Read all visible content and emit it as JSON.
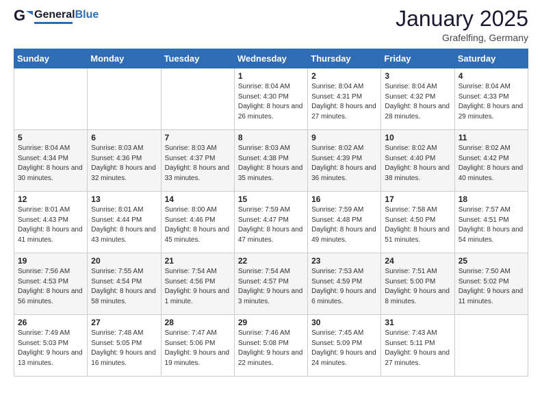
{
  "header": {
    "logo_general": "General",
    "logo_blue": "Blue",
    "month_title": "January 2025",
    "location": "Grafelfing, Germany"
  },
  "days_of_week": [
    "Sunday",
    "Monday",
    "Tuesday",
    "Wednesday",
    "Thursday",
    "Friday",
    "Saturday"
  ],
  "weeks": [
    [
      {
        "day": null
      },
      {
        "day": null
      },
      {
        "day": null
      },
      {
        "day": "1",
        "sunrise": "8:04 AM",
        "sunset": "4:30 PM",
        "daylight": "8 hours and 26 minutes."
      },
      {
        "day": "2",
        "sunrise": "8:04 AM",
        "sunset": "4:31 PM",
        "daylight": "8 hours and 27 minutes."
      },
      {
        "day": "3",
        "sunrise": "8:04 AM",
        "sunset": "4:32 PM",
        "daylight": "8 hours and 28 minutes."
      },
      {
        "day": "4",
        "sunrise": "8:04 AM",
        "sunset": "4:33 PM",
        "daylight": "8 hours and 29 minutes."
      }
    ],
    [
      {
        "day": "5",
        "sunrise": "8:04 AM",
        "sunset": "4:34 PM",
        "daylight": "8 hours and 30 minutes."
      },
      {
        "day": "6",
        "sunrise": "8:03 AM",
        "sunset": "4:36 PM",
        "daylight": "8 hours and 32 minutes."
      },
      {
        "day": "7",
        "sunrise": "8:03 AM",
        "sunset": "4:37 PM",
        "daylight": "8 hours and 33 minutes."
      },
      {
        "day": "8",
        "sunrise": "8:03 AM",
        "sunset": "4:38 PM",
        "daylight": "8 hours and 35 minutes."
      },
      {
        "day": "9",
        "sunrise": "8:02 AM",
        "sunset": "4:39 PM",
        "daylight": "8 hours and 36 minutes."
      },
      {
        "day": "10",
        "sunrise": "8:02 AM",
        "sunset": "4:40 PM",
        "daylight": "8 hours and 38 minutes."
      },
      {
        "day": "11",
        "sunrise": "8:02 AM",
        "sunset": "4:42 PM",
        "daylight": "8 hours and 40 minutes."
      }
    ],
    [
      {
        "day": "12",
        "sunrise": "8:01 AM",
        "sunset": "4:43 PM",
        "daylight": "8 hours and 41 minutes."
      },
      {
        "day": "13",
        "sunrise": "8:01 AM",
        "sunset": "4:44 PM",
        "daylight": "8 hours and 43 minutes."
      },
      {
        "day": "14",
        "sunrise": "8:00 AM",
        "sunset": "4:46 PM",
        "daylight": "8 hours and 45 minutes."
      },
      {
        "day": "15",
        "sunrise": "7:59 AM",
        "sunset": "4:47 PM",
        "daylight": "8 hours and 47 minutes."
      },
      {
        "day": "16",
        "sunrise": "7:59 AM",
        "sunset": "4:48 PM",
        "daylight": "8 hours and 49 minutes."
      },
      {
        "day": "17",
        "sunrise": "7:58 AM",
        "sunset": "4:50 PM",
        "daylight": "8 hours and 51 minutes."
      },
      {
        "day": "18",
        "sunrise": "7:57 AM",
        "sunset": "4:51 PM",
        "daylight": "8 hours and 54 minutes."
      }
    ],
    [
      {
        "day": "19",
        "sunrise": "7:56 AM",
        "sunset": "4:53 PM",
        "daylight": "8 hours and 56 minutes."
      },
      {
        "day": "20",
        "sunrise": "7:55 AM",
        "sunset": "4:54 PM",
        "daylight": "8 hours and 58 minutes."
      },
      {
        "day": "21",
        "sunrise": "7:54 AM",
        "sunset": "4:56 PM",
        "daylight": "9 hours and 1 minute."
      },
      {
        "day": "22",
        "sunrise": "7:54 AM",
        "sunset": "4:57 PM",
        "daylight": "9 hours and 3 minutes."
      },
      {
        "day": "23",
        "sunrise": "7:53 AM",
        "sunset": "4:59 PM",
        "daylight": "9 hours and 6 minutes."
      },
      {
        "day": "24",
        "sunrise": "7:51 AM",
        "sunset": "5:00 PM",
        "daylight": "9 hours and 8 minutes."
      },
      {
        "day": "25",
        "sunrise": "7:50 AM",
        "sunset": "5:02 PM",
        "daylight": "9 hours and 11 minutes."
      }
    ],
    [
      {
        "day": "26",
        "sunrise": "7:49 AM",
        "sunset": "5:03 PM",
        "daylight": "9 hours and 13 minutes."
      },
      {
        "day": "27",
        "sunrise": "7:48 AM",
        "sunset": "5:05 PM",
        "daylight": "9 hours and 16 minutes."
      },
      {
        "day": "28",
        "sunrise": "7:47 AM",
        "sunset": "5:06 PM",
        "daylight": "9 hours and 19 minutes."
      },
      {
        "day": "29",
        "sunrise": "7:46 AM",
        "sunset": "5:08 PM",
        "daylight": "9 hours and 22 minutes."
      },
      {
        "day": "30",
        "sunrise": "7:45 AM",
        "sunset": "5:09 PM",
        "daylight": "9 hours and 24 minutes."
      },
      {
        "day": "31",
        "sunrise": "7:43 AM",
        "sunset": "5:11 PM",
        "daylight": "9 hours and 27 minutes."
      },
      {
        "day": null
      }
    ]
  ],
  "labels": {
    "sunrise": "Sunrise: ",
    "sunset": "Sunset: ",
    "daylight": "Daylight: "
  }
}
